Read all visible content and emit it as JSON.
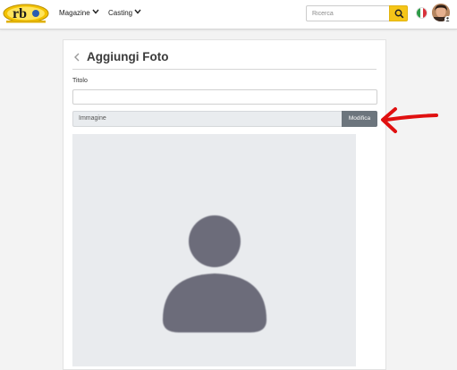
{
  "navbar": {
    "logo_alt": "rb",
    "magazine_label": "Magazine",
    "casting_label": "Casting",
    "search": {
      "placeholder": "Ricerca",
      "button_icon": "search-icon"
    },
    "language_icon": "italy-flag-icon",
    "user_icon": "user-avatar"
  },
  "form": {
    "back_icon": "chevron-left-icon",
    "title": "Aggiungi Foto",
    "title_field_label": "Titolo",
    "title_field_value": "",
    "file_field_label": "Immagine",
    "file_button_label": "Modifica",
    "preview_icon": "person-placeholder-icon"
  },
  "annotation": {
    "icon": "red-arrow-icon",
    "color": "#e01010"
  },
  "colors": {
    "accent": "#f5c518",
    "secondary_button": "#6c757d",
    "preview_bg": "#e9ebee",
    "placeholder_person": "#6c6c7a"
  }
}
